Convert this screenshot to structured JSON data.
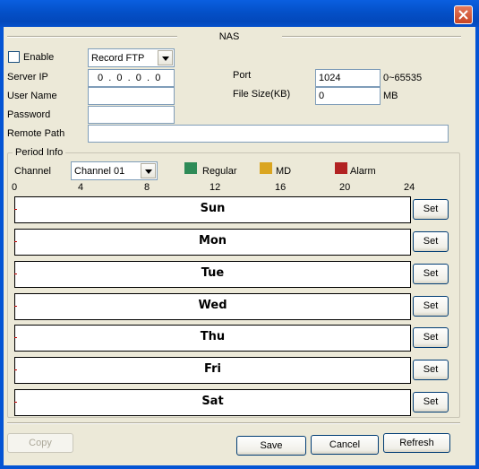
{
  "window": {
    "close_icon": "close-icon"
  },
  "header": {
    "title": "NAS"
  },
  "form": {
    "enable_label": "Enable",
    "enable_checked": false,
    "type_value": "Record FTP",
    "server_ip_label": "Server IP",
    "server_ip_value": "0  .  0  .  0  .  0",
    "port_label": "Port",
    "port_value": "1024",
    "port_hint": "0~65535",
    "user_name_label": "User Name",
    "user_name_value": "",
    "file_size_label": "File Size(KB)",
    "file_size_value": "0",
    "file_size_unit": "MB",
    "password_label": "Password",
    "password_value": "",
    "remote_path_label": "Remote Path",
    "remote_path_value": ""
  },
  "period": {
    "group_title": "Period Info",
    "channel_label": "Channel",
    "channel_value": "Channel 01",
    "legend": [
      {
        "label": "Regular",
        "color": "#2e8b57"
      },
      {
        "label": "MD",
        "color": "#daa520"
      },
      {
        "label": "Alarm",
        "color": "#b22222"
      }
    ],
    "hours": [
      "0",
      "4",
      "8",
      "12",
      "16",
      "20",
      "24"
    ],
    "days": [
      "Sun",
      "Mon",
      "Tue",
      "Wed",
      "Thu",
      "Fri",
      "Sat"
    ],
    "set_label": "Set"
  },
  "footer": {
    "copy_label": "Copy",
    "save_label": "Save",
    "cancel_label": "Cancel",
    "refresh_label": "Refresh"
  }
}
